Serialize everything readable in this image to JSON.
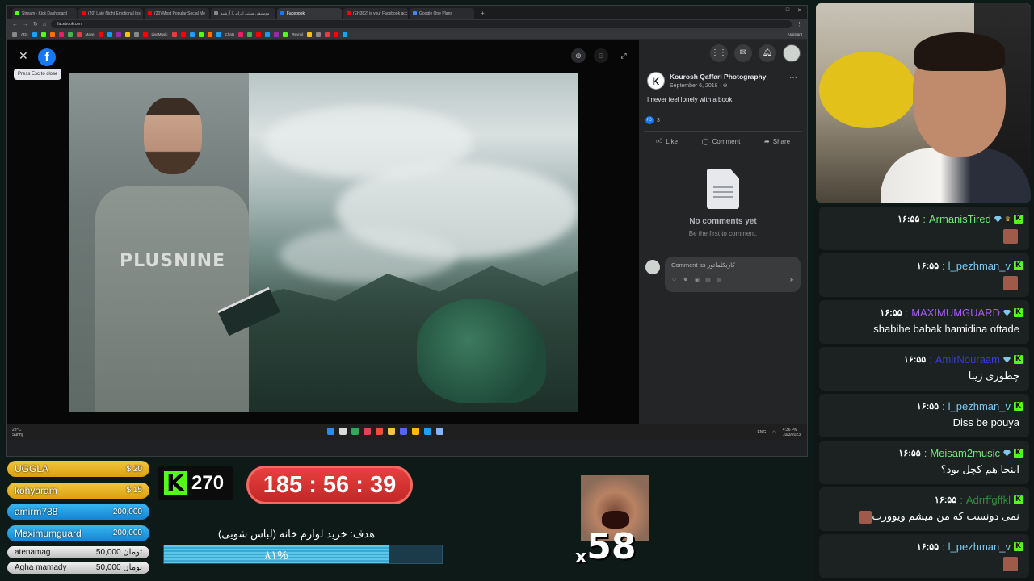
{
  "browser": {
    "tabs": [
      {
        "label": "Stream - Kick Dashboard",
        "color": "#53fc18",
        "active": false
      },
      {
        "label": "(20) Late Night Emotional Ins",
        "color": "#ff0000",
        "active": false
      },
      {
        "label": "(20) Most Popular Social Me",
        "color": "#ff0000",
        "active": false
      },
      {
        "label": "موسیقی سنتی ایرانی | آرشیو",
        "color": "#888888",
        "active": false
      },
      {
        "label": "Facebook",
        "color": "#1877f2",
        "active": true
      },
      {
        "label": "(EH382) is your Facebook acc",
        "color": "#ff0000",
        "active": false
      },
      {
        "label": "Google One Plans",
        "color": "#4285f4",
        "active": false
      }
    ],
    "new_tab": "+",
    "url": "facebook.com",
    "bookmarks": [
      "ADs",
      "Maye",
      "LiveMusic",
      "Chats",
      "Reynol"
    ],
    "assistant": "Assistant"
  },
  "viewer": {
    "tooltip": "Press Esc to close",
    "fb_letter": "f",
    "shirt_text": "PLUSNINE"
  },
  "post": {
    "author": "Kourosh Qaffari Photography",
    "author_initial": "K",
    "date": "September 6, 2018 · ⊕",
    "caption": "I never feel lonely with a book",
    "reaction_count": "3",
    "actions": {
      "like": "Like",
      "comment": "Comment",
      "share": "Share"
    },
    "no_comments_title": "No comments yet",
    "no_comments_sub": "Be the first to comment.",
    "comment_placeholder": "Comment as کاربکلماتور"
  },
  "taskbar": {
    "weather": "28°C\nSunny",
    "lang": "ENG",
    "time": "4:36 PM",
    "date": "10/3/2023"
  },
  "chat": [
    {
      "user": "ArmanisTired",
      "color": "#6ee87a",
      "time": "۱۶:۵۵",
      "text": "",
      "emote": true,
      "badges": [
        "gem",
        "crown"
      ]
    },
    {
      "user": "l_pezhman_v",
      "color": "#7ec8f0",
      "time": "۱۶:۵۵",
      "text": "",
      "emote": true,
      "badges": []
    },
    {
      "user": "MAXIMUMGUARD",
      "color": "#a45cf5",
      "time": "۱۶:۵۵",
      "text": "shabihe babak hamidina oftade",
      "emote": false,
      "badges": [
        "gem"
      ]
    },
    {
      "user": "AmirNouraam",
      "color": "#3b3bd6",
      "time": "۱۶:۵۵",
      "text": "چطوری زیبا",
      "emote": false,
      "badges": [
        "gem"
      ]
    },
    {
      "user": "l_pezhman_v",
      "color": "#7ec8f0",
      "time": "۱۶:۵۵",
      "text": "Diss be pouya",
      "emote": false,
      "badges": []
    },
    {
      "user": "Meisam2music",
      "color": "#6ee87a",
      "time": "۱۶:۵۵",
      "text": "اینجا هم کچل بود؟",
      "emote": false,
      "badges": [
        "gem"
      ]
    },
    {
      "user": "Adrrffgffkl",
      "color": "#2f8f3f",
      "time": "۱۶:۵۵",
      "text": "نمی دونست که من میشم ویوورت",
      "emote": false,
      "badges": [],
      "inline_emote": true
    },
    {
      "user": "l_pezhman_v",
      "color": "#7ec8f0",
      "time": "۱۶:۵۵",
      "text": "",
      "emote": true,
      "badges": []
    }
  ],
  "donors": [
    {
      "name": "UGGLA",
      "amount": "$ 20",
      "style": "gold"
    },
    {
      "name": "kohyaram",
      "amount": "$ 15",
      "style": "gold"
    },
    {
      "name": "amirm788",
      "amount": "200,000",
      "style": "blue"
    },
    {
      "name": "Maximumguard",
      "amount": "200,000",
      "style": "blue"
    },
    {
      "name": "atenamag",
      "amount": "50,000 تومان",
      "style": "gray"
    },
    {
      "name": "Agha mamady",
      "amount": "50,000 تومان",
      "style": "gray"
    }
  ],
  "kick": {
    "letter": "K",
    "count": "270"
  },
  "timer": "185 : 56 : 39",
  "goal": {
    "title": "هدف: خرید لوازم خانه (لباس شویی)",
    "percent_label": "۸۱%",
    "fraction": 0.81
  },
  "combo": {
    "x": "x",
    "count": "58"
  },
  "colors": {
    "kick_green": "#53fc18",
    "fb_blue": "#1877f2",
    "timer_red": "#d83131"
  }
}
